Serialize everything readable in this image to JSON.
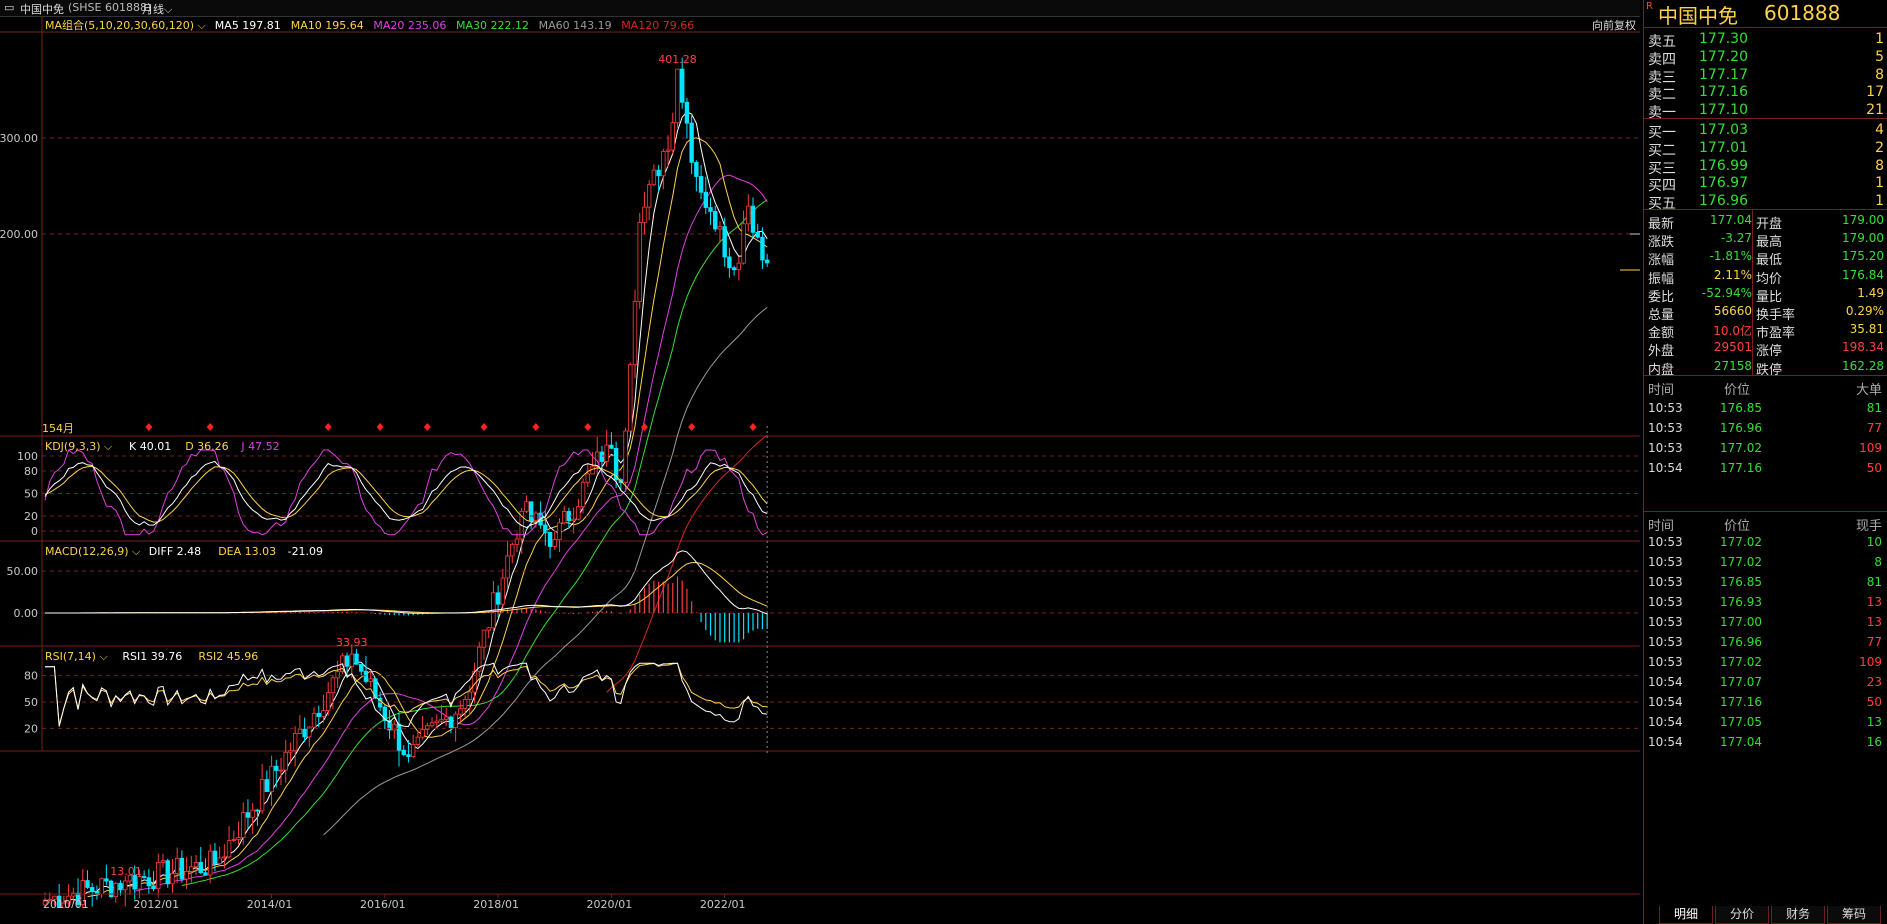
{
  "header": {
    "stock_name": "中国中免",
    "market_code": "(SHSE 601888)",
    "period": "月线",
    "adjust_label": "向前复权"
  },
  "colors": {
    "up": "#ff3c3c",
    "down": "#00e5ff",
    "ma5": "#ffffff",
    "ma10": "#ffd24a",
    "ma20": "#e040e0",
    "ma30": "#33e033",
    "ma60": "#9a9a9a",
    "ma120": "#d92525"
  },
  "main_panel": {
    "indicator_label": "MA组合(5,10,20,30,60,120)",
    "ma_labels": [
      {
        "text": "MA5 197.81",
        "color": "#ffffff"
      },
      {
        "text": "MA10 195.64",
        "color": "#ffd24a"
      },
      {
        "text": "MA20 235.06",
        "color": "#e040e0"
      },
      {
        "text": "MA30 222.12",
        "color": "#33e033"
      },
      {
        "text": "MA60 143.19",
        "color": "#9a9a9a"
      },
      {
        "text": "MA120 79.66",
        "color": "#d92525"
      }
    ],
    "y_ticks": [
      "300.00",
      "200.00"
    ],
    "peak_label": "401.28",
    "low_label_1": "13.01",
    "low_label_2": "33.93",
    "bar_count_label": "154月"
  },
  "kdj_panel": {
    "label": "KDJ(9,3,3)",
    "values": [
      {
        "text": "K 40.01",
        "color": "#ffffff"
      },
      {
        "text": "D 36.26",
        "color": "#ffd24a"
      },
      {
        "text": "J 47.52",
        "color": "#e040e0"
      }
    ],
    "y_ticks": [
      "100",
      "80",
      "50",
      "20",
      "0"
    ]
  },
  "macd_panel": {
    "label": "MACD(12,26,9)",
    "values": [
      {
        "text": "DIFF 2.48",
        "color": "#ffffff"
      },
      {
        "text": "DEA 13.03",
        "color": "#ffd24a"
      },
      {
        "text": "-21.09",
        "color": "#ffffff"
      }
    ],
    "y_ticks": [
      "50.00",
      "0.00"
    ]
  },
  "rsi_panel": {
    "label": "RSI(7,14)",
    "values": [
      {
        "text": "RSI1 39.76",
        "color": "#ffffff"
      },
      {
        "text": "RSI2 45.96",
        "color": "#ffd24a"
      }
    ],
    "y_ticks": [
      "80",
      "50",
      "20"
    ]
  },
  "x_axis_labels": [
    "2010/01",
    "2012/01",
    "2014/01",
    "2016/01",
    "2018/01",
    "2020/01",
    "2022/01"
  ],
  "chart_data": {
    "type": "candlestick",
    "period": "monthly",
    "x_start": "2010/01",
    "bars": 154,
    "price_anchors": [
      {
        "date": "2010/01",
        "close": 12
      },
      {
        "date": "2011/06",
        "close": 13.01
      },
      {
        "date": "2013/01",
        "close": 14
      },
      {
        "date": "2015/06",
        "close": 33.93
      },
      {
        "date": "2016/06",
        "close": 22
      },
      {
        "date": "2017/06",
        "close": 28
      },
      {
        "date": "2018/06",
        "close": 62
      },
      {
        "date": "2019/01",
        "close": 55
      },
      {
        "date": "2019/12",
        "close": 82
      },
      {
        "date": "2020/03",
        "close": 70
      },
      {
        "date": "2020/07",
        "close": 210
      },
      {
        "date": "2021/02",
        "close": 320
      },
      {
        "date": "2021/03",
        "close": 401.28
      },
      {
        "date": "2021/07",
        "close": 255
      },
      {
        "date": "2021/10",
        "close": 220
      },
      {
        "date": "2022/03",
        "close": 172
      },
      {
        "date": "2022/06",
        "close": 225
      },
      {
        "date": "2022/10",
        "close": 177.04
      }
    ],
    "y_scale": "log",
    "kdj_latest": {
      "K": 40.01,
      "D": 36.26,
      "J": 47.52
    },
    "macd_latest": {
      "DIFF": 2.48,
      "DEA": 13.03,
      "MACD": -21.09
    },
    "rsi_latest": {
      "RSI1": 39.76,
      "RSI2": 45.96
    }
  },
  "quote": {
    "title": "中国中免",
    "code": "601888",
    "r_mark": "R",
    "asks": [
      {
        "label": "卖五",
        "price": "177.30",
        "vol": "1"
      },
      {
        "label": "卖四",
        "price": "177.20",
        "vol": "5"
      },
      {
        "label": "卖三",
        "price": "177.17",
        "vol": "8"
      },
      {
        "label": "卖二",
        "price": "177.16",
        "vol": "17"
      },
      {
        "label": "卖一",
        "price": "177.10",
        "vol": "21"
      }
    ],
    "bids": [
      {
        "label": "买一",
        "price": "177.03",
        "vol": "4"
      },
      {
        "label": "买二",
        "price": "177.01",
        "vol": "2"
      },
      {
        "label": "买三",
        "price": "176.99",
        "vol": "8"
      },
      {
        "label": "买四",
        "price": "176.97",
        "vol": "1"
      },
      {
        "label": "买五",
        "price": "176.96",
        "vol": "1"
      }
    ],
    "stats": [
      {
        "l1": "最新",
        "v1": "177.04",
        "c1": "green",
        "l2": "开盘",
        "v2": "179.00",
        "c2": "green"
      },
      {
        "l1": "涨跌",
        "v1": "-3.27",
        "c1": "green",
        "l2": "最高",
        "v2": "179.00",
        "c2": "green"
      },
      {
        "l1": "涨幅",
        "v1": "-1.81%",
        "c1": "green",
        "l2": "最低",
        "v2": "175.20",
        "c2": "green"
      },
      {
        "l1": "振幅",
        "v1": "2.11%",
        "c1": "yellow",
        "l2": "均价",
        "v2": "176.84",
        "c2": "green"
      },
      {
        "l1": "委比",
        "v1": "-52.94%",
        "c1": "green",
        "l2": "量比",
        "v2": "1.49",
        "c2": "yellow"
      },
      {
        "l1": "总量",
        "v1": "56660",
        "c1": "yellow",
        "l2": "换手率",
        "v2": "0.29%",
        "c2": "yellow"
      },
      {
        "l1": "金额",
        "v1": "10.0亿",
        "c1": "red",
        "l2": "市盈率",
        "v2": "35.81",
        "c2": "yellow"
      },
      {
        "l1": "外盘",
        "v1": "29501",
        "c1": "red",
        "l2": "涨停",
        "v2": "198.34",
        "c2": "red"
      },
      {
        "l1": "内盘",
        "v1": "27158",
        "c1": "green",
        "l2": "跌停",
        "v2": "162.28",
        "c2": "green"
      }
    ],
    "big_trades_header": {
      "time": "时间",
      "price": "价位",
      "vol": "大单"
    },
    "big_trades": [
      {
        "time": "10:53",
        "price": "176.85",
        "vol": "81",
        "vc": "green"
      },
      {
        "time": "10:53",
        "price": "176.96",
        "vol": "77",
        "vc": "red"
      },
      {
        "time": "10:53",
        "price": "177.02",
        "vol": "109",
        "vc": "red"
      },
      {
        "time": "10:54",
        "price": "177.16",
        "vol": "50",
        "vc": "red"
      }
    ],
    "ticks_header": {
      "time": "时间",
      "price": "价位",
      "vol": "现手"
    },
    "ticks": [
      {
        "time": "10:53",
        "price": "177.02",
        "vol": "10",
        "vc": "green"
      },
      {
        "time": "10:53",
        "price": "177.02",
        "vol": "8",
        "vc": "green"
      },
      {
        "time": "10:53",
        "price": "176.85",
        "vol": "81",
        "vc": "green"
      },
      {
        "time": "10:53",
        "price": "176.93",
        "vol": "13",
        "vc": "red"
      },
      {
        "time": "10:53",
        "price": "177.00",
        "vol": "13",
        "vc": "red"
      },
      {
        "time": "10:53",
        "price": "176.96",
        "vol": "77",
        "vc": "red"
      },
      {
        "time": "10:53",
        "price": "177.02",
        "vol": "109",
        "vc": "red"
      },
      {
        "time": "10:54",
        "price": "177.07",
        "vol": "23",
        "vc": "red"
      },
      {
        "time": "10:54",
        "price": "177.16",
        "vol": "50",
        "vc": "red"
      },
      {
        "time": "10:54",
        "price": "177.05",
        "vol": "13",
        "vc": "green"
      },
      {
        "time": "10:54",
        "price": "177.04",
        "vol": "16",
        "vc": "green"
      }
    ],
    "tabs": [
      "明细",
      "分价",
      "财务",
      "筹码"
    ]
  }
}
